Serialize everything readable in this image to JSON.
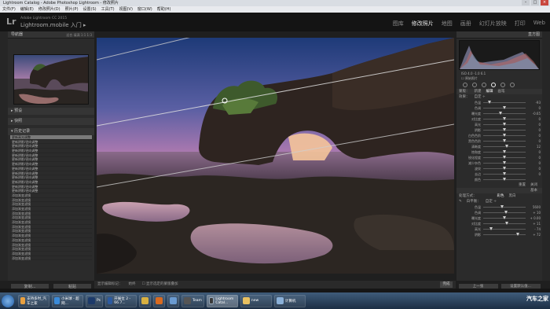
{
  "titlebar": {
    "title": "Lightroom Catalog - Adobe Photoshop Lightroom - 修改照片"
  },
  "menu": [
    "文件(F)",
    "编辑(E)",
    "修改照片(D)",
    "照片(P)",
    "设置(S)",
    "工具(T)",
    "视图(V)",
    "窗口(W)",
    "帮助(H)"
  ],
  "identity": {
    "logo": "Lr",
    "product": "Adobe Lightroom CC 2015",
    "catalog": "Lightroom.mobile 入门 ▸"
  },
  "modules": [
    "图库",
    "修改照片",
    "地图",
    "画册",
    "幻灯片放映",
    "打印",
    "Web"
  ],
  "left": {
    "navigator": "导航器",
    "nav_zoom": "适合  填满  1:1  1:3",
    "presets": "预设",
    "snapshots": "快照",
    "history": "历史记录",
    "history_items": [
      "更新高光调整",
      "更新阴影/径向调整",
      "更新阴影/径向调整",
      "更新阴影/径向调整",
      "更新阴影/径向调整",
      "更新阴影/径向调整",
      "更新阴影/径向调整",
      "更新阴影/径向调整",
      "更新阴影/径向调整",
      "更新阴影/径向调整",
      "更新阴影/径向调整",
      "更新阴影/径向调整",
      "更新阴影/径向调整",
      "添加渐变滤镜",
      "添加渐变滤镜",
      "添加渐变滤镜",
      "添加渐变滤镜",
      "添加渐变滤镜",
      "添加渐变滤镜",
      "添加渐变滤镜",
      "添加渐变滤镜",
      "添加渐变滤镜",
      "添加渐变滤镜",
      "添加渐变滤镜",
      "添加渐变滤镜",
      "添加渐变滤镜",
      "添加渐变滤镜",
      "添加渐变滤镜"
    ],
    "copy": "复制...",
    "paste": "粘贴"
  },
  "toolbar": {
    "show": "显示编辑标记：",
    "mode": "始终",
    "mask": "显示选定的蒙版叠加",
    "done": "完成"
  },
  "right": {
    "histogram": "直方图",
    "hist_info": "ISO  4.0  -1.0  6.1",
    "original": "原始照片",
    "mask_tabs": [
      "蒙版：",
      "新建",
      "编辑",
      "画笔"
    ],
    "effect": "效果：",
    "effect_val": "自定 ÷",
    "sliders": [
      {
        "label": "色温",
        "value": "-93",
        "pos": 0.15
      },
      {
        "label": "色调",
        "value": "0",
        "pos": 0.5
      },
      {
        "label": "曝光度",
        "value": "-0.65",
        "pos": 0.42
      },
      {
        "label": "对比度",
        "value": "0",
        "pos": 0.5
      },
      {
        "label": "高光",
        "value": "0",
        "pos": 0.5
      },
      {
        "label": "阴影",
        "value": "0",
        "pos": 0.5
      },
      {
        "label": "白色色阶",
        "value": "0",
        "pos": 0.5
      },
      {
        "label": "黑色色阶",
        "value": "0",
        "pos": 0.5
      },
      {
        "label": "清晰度",
        "value": "12",
        "pos": 0.56
      },
      {
        "label": "饱和度",
        "value": "0",
        "pos": 0.5
      },
      {
        "label": "锐化程度",
        "value": "0",
        "pos": 0.5
      },
      {
        "label": "减少杂色",
        "value": "0",
        "pos": 0.5
      },
      {
        "label": "波纹",
        "value": "0",
        "pos": 0.5
      },
      {
        "label": "去边",
        "value": "0",
        "pos": 0.5
      },
      {
        "label": "颜色",
        "value": "",
        "pos": 0.5
      }
    ],
    "reset": "重置",
    "close": "关闭",
    "basic": "基本",
    "treatment": "处理方式：",
    "color": "彩色",
    "bw": "黑白",
    "wb": "白平衡：",
    "wb_val": "自定 ÷",
    "basic_sliders": [
      {
        "label": "色温",
        "value": "5600",
        "pos": 0.45
      },
      {
        "label": "色调",
        "value": "+ 10",
        "pos": 0.55
      },
      {
        "label": "曝光度",
        "value": "+ 0.00",
        "pos": 0.5
      },
      {
        "label": "对比度",
        "value": "+ 11",
        "pos": 0.56
      },
      {
        "label": "高光",
        "value": "- 74",
        "pos": 0.2
      },
      {
        "label": "阴影",
        "value": "+ 72",
        "pos": 0.82
      }
    ],
    "tone": "色调",
    "tone_auto": "自动",
    "prev": "上一张",
    "reset_all": "设置默认值..."
  },
  "taskbar": {
    "items": [
      "支持多时_汽车之家",
      "小米球 - 超网...",
      "Ps",
      "开展位 2 - 66.7...",
      "",
      "",
      "",
      "Team",
      "Lightroom Catal...",
      "new",
      "计算机"
    ],
    "watermark": "汽车之家"
  }
}
